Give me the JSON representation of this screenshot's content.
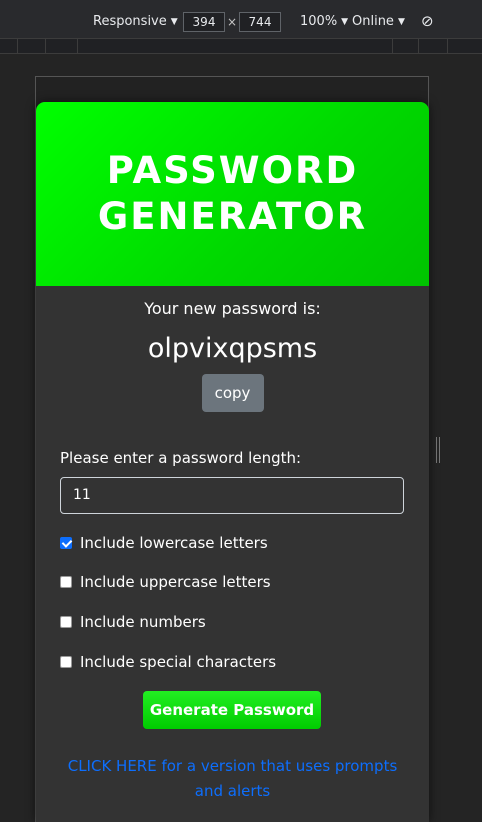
{
  "devtools": {
    "device_label": "Responsive",
    "width_value": "394",
    "height_value": "744",
    "zoom_label": "100%",
    "network_label": "Online",
    "rotate_icon": "rotate-icon"
  },
  "app": {
    "title": "PASSWORD GENERATOR",
    "new_password_label": "Your new password is:",
    "password_value": "olpvixqpsms",
    "copy_label": "copy",
    "length_label": "Please enter a password length:",
    "length_value": "11",
    "options": [
      {
        "label": "Include lowercase letters",
        "checked": true
      },
      {
        "label": "Include uppercase letters",
        "checked": false
      },
      {
        "label": "Include numbers",
        "checked": false
      },
      {
        "label": "Include special characters",
        "checked": false
      }
    ],
    "generate_label": "Generate Password",
    "alt_link": "CLICK HERE for a version that uses prompts and alerts"
  },
  "colors": {
    "header_green": "#00ff00",
    "card_bg": "#333333",
    "link_blue": "#0d6efd",
    "copy_button": "#6c757d"
  }
}
